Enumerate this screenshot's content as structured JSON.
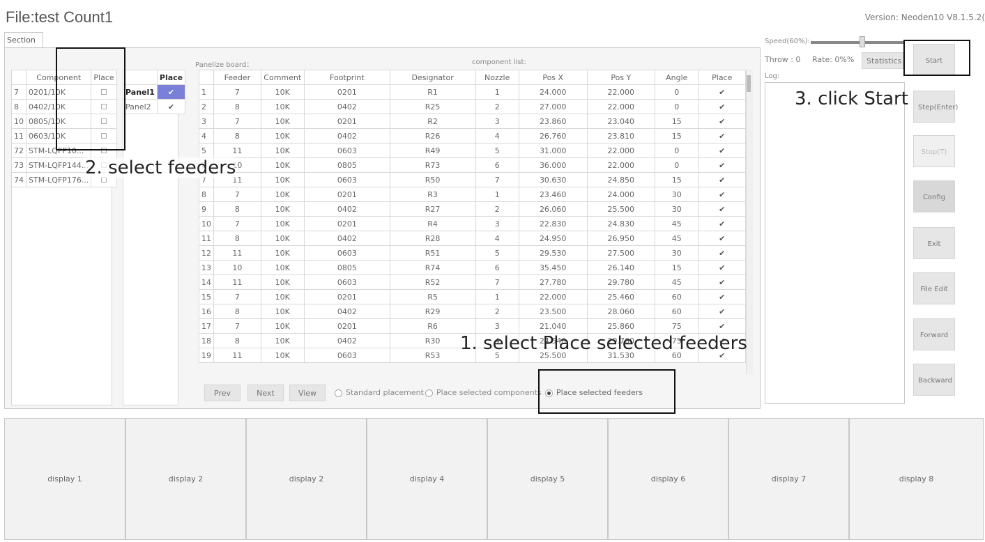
{
  "header": {
    "title": "File:test Count1",
    "version": "Version: Neoden10 V8.1.5.2("
  },
  "tabs": [
    "Section 1"
  ],
  "labels": {
    "panelize": "Panelize board：",
    "component_list": "component list:",
    "speed": "Speed(60%):",
    "throw": "Throw : 0",
    "rate": "Rate: 0%%",
    "log": "Log:"
  },
  "speed_percent": 60,
  "components": {
    "headers": [
      "",
      "Component",
      "Place"
    ],
    "rows": [
      [
        "7",
        "0201/10K"
      ],
      [
        "8",
        "0402/10K"
      ],
      [
        "10",
        "0805/10K"
      ],
      [
        "11",
        "0603/10K"
      ],
      [
        "72",
        "STM-LQFP10..."
      ],
      [
        "73",
        "STM-LQFP144..."
      ],
      [
        "74",
        "STM-LQFP176..."
      ]
    ]
  },
  "panels": {
    "header": "Place",
    "rows": [
      "Panel1",
      "Panel2"
    ]
  },
  "feeders_table": {
    "headers": [
      "",
      "Feeder",
      "Comment",
      "Footprint",
      "Designator",
      "Nozzle",
      "Pos X",
      "Pos Y",
      "Angle",
      "Place"
    ],
    "rows": [
      [
        "1",
        "7",
        "10K",
        "0201",
        "R1",
        "1",
        "24.000",
        "22.000",
        "0"
      ],
      [
        "2",
        "8",
        "10K",
        "0402",
        "R25",
        "2",
        "27.000",
        "22.000",
        "0"
      ],
      [
        "3",
        "7",
        "10K",
        "0201",
        "R2",
        "3",
        "23.860",
        "23.040",
        "15"
      ],
      [
        "4",
        "8",
        "10K",
        "0402",
        "R26",
        "4",
        "26.760",
        "23.810",
        "15"
      ],
      [
        "5",
        "11",
        "10K",
        "0603",
        "R49",
        "5",
        "31.000",
        "22.000",
        "0"
      ],
      [
        "6",
        "10",
        "10K",
        "0805",
        "R73",
        "6",
        "36.000",
        "22.000",
        "0"
      ],
      [
        "7",
        "11",
        "10K",
        "0603",
        "R50",
        "7",
        "30.630",
        "24.850",
        "15"
      ],
      [
        "8",
        "7",
        "10K",
        "0201",
        "R3",
        "1",
        "23.460",
        "24.000",
        "30"
      ],
      [
        "9",
        "8",
        "10K",
        "0402",
        "R27",
        "2",
        "26.060",
        "25.500",
        "30"
      ],
      [
        "10",
        "7",
        "10K",
        "0201",
        "R4",
        "3",
        "22.830",
        "24.830",
        "45"
      ],
      [
        "11",
        "8",
        "10K",
        "0402",
        "R28",
        "4",
        "24.950",
        "26.950",
        "45"
      ],
      [
        "12",
        "11",
        "10K",
        "0603",
        "R51",
        "5",
        "29.530",
        "27.500",
        "30"
      ],
      [
        "13",
        "10",
        "10K",
        "0805",
        "R74",
        "6",
        "35.450",
        "26.140",
        "15"
      ],
      [
        "14",
        "11",
        "10K",
        "0603",
        "R52",
        "7",
        "27.780",
        "29.780",
        "45"
      ],
      [
        "15",
        "7",
        "10K",
        "0201",
        "R5",
        "1",
        "22.000",
        "25.460",
        "60"
      ],
      [
        "16",
        "8",
        "10K",
        "0402",
        "R29",
        "2",
        "23.500",
        "28.060",
        "60"
      ],
      [
        "17",
        "7",
        "10K",
        "0201",
        "R6",
        "3",
        "21.040",
        "25.860",
        "75"
      ],
      [
        "18",
        "8",
        "10K",
        "0402",
        "R30",
        "4",
        "24.540",
        "29.760",
        "75"
      ],
      [
        "19",
        "11",
        "10K",
        "0603",
        "R53",
        "5",
        "25.500",
        "31.530",
        "60"
      ]
    ]
  },
  "bottom_bar": {
    "prev": "Prev",
    "next": "Next",
    "view": "View",
    "radio_standard": "Standard placement",
    "radio_components": "Place selected components",
    "radio_feeders": "Place selected feeders",
    "selected": "radio_feeders"
  },
  "right_panel": {
    "statistics": "Statistics",
    "start": "Start",
    "step": "Step(Enter)",
    "stop": "Stop(T)",
    "config": "Config",
    "exit": "Exit",
    "file_edit": "File Edit",
    "forward": "Forward",
    "backward": "Backward"
  },
  "displays": [
    "display 1",
    "display 2",
    "display 2",
    "display 4",
    "display 5",
    "display 6",
    "display 7",
    "display 8"
  ],
  "annotations": {
    "a1": "1. select Place selected feeders",
    "a2": "2. select feeders",
    "a3": "3. click Start"
  }
}
